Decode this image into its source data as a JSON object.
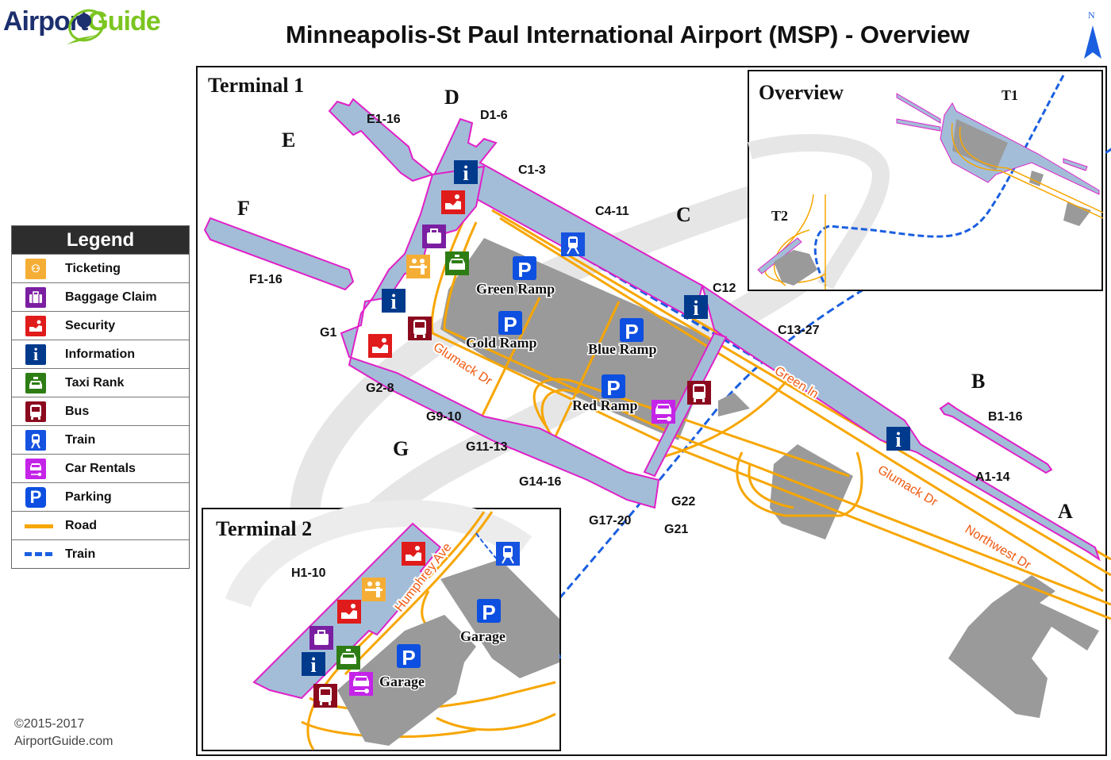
{
  "header": {
    "logo_part1": "Airport",
    "logo_part2": "Guide",
    "title": "Minneapolis-St Paul International Airport (MSP) - Overview",
    "north_label": "N"
  },
  "colors": {
    "terminal_fill": "#a3bdd8",
    "terminal_outline": "#e020c8",
    "road": "#f7a600",
    "train": "#1a5fe0",
    "building": "#9a9a9a",
    "ticketing": "#f5ae35",
    "baggage": "#7b1fa2",
    "security": "#e01b1b",
    "information": "#003a8c",
    "taxi": "#2e7d14",
    "bus": "#8b0a1e",
    "train_icon": "#1553e0",
    "car_rentals": "#c424e8",
    "parking": "#0d4fe0"
  },
  "legend": {
    "title": "Legend",
    "items": [
      {
        "label": "Ticketing",
        "icon": "ticketing-icon"
      },
      {
        "label": "Baggage Claim",
        "icon": "baggage-claim-icon"
      },
      {
        "label": "Security",
        "icon": "security-icon"
      },
      {
        "label": "Information",
        "icon": "information-icon"
      },
      {
        "label": "Taxi Rank",
        "icon": "taxi-icon"
      },
      {
        "label": "Bus",
        "icon": "bus-icon"
      },
      {
        "label": "Train",
        "icon": "train-icon"
      },
      {
        "label": "Car Rentals",
        "icon": "car-rental-icon"
      },
      {
        "label": "Parking",
        "icon": "parking-icon"
      },
      {
        "label": "Road",
        "icon": "road-line"
      },
      {
        "label": "Train",
        "icon": "train-line"
      }
    ]
  },
  "terminal1": {
    "title": "Terminal 1",
    "concourses": [
      "A",
      "B",
      "C",
      "D",
      "E",
      "F",
      "G"
    ],
    "gates": [
      "E1-16",
      "D1-6",
      "C1-3",
      "C4-11",
      "C12",
      "C13-27",
      "F1-16",
      "G1",
      "G2-8",
      "G9-10",
      "G11-13",
      "G14-16",
      "G17-20",
      "G21",
      "G22",
      "B1-16",
      "A1-14"
    ],
    "parking": [
      "Green Ramp",
      "Gold Ramp",
      "Blue Ramp",
      "Red Ramp"
    ],
    "roads": [
      "Glumack Dr",
      "Green ln",
      "Glumack Dr",
      "Northwest Dr"
    ]
  },
  "overview": {
    "title": "Overview",
    "t1": "T1",
    "t2": "T2"
  },
  "terminal2": {
    "title": "Terminal 2",
    "gates": "H1-10",
    "road": "Humphrey Ave",
    "parking": [
      "Garage",
      "Garage"
    ]
  },
  "icons": {
    "parking_letter": "P",
    "info_letter": "i"
  },
  "footer": {
    "copyright": "©2015-2017",
    "site": "AirportGuide.com"
  }
}
